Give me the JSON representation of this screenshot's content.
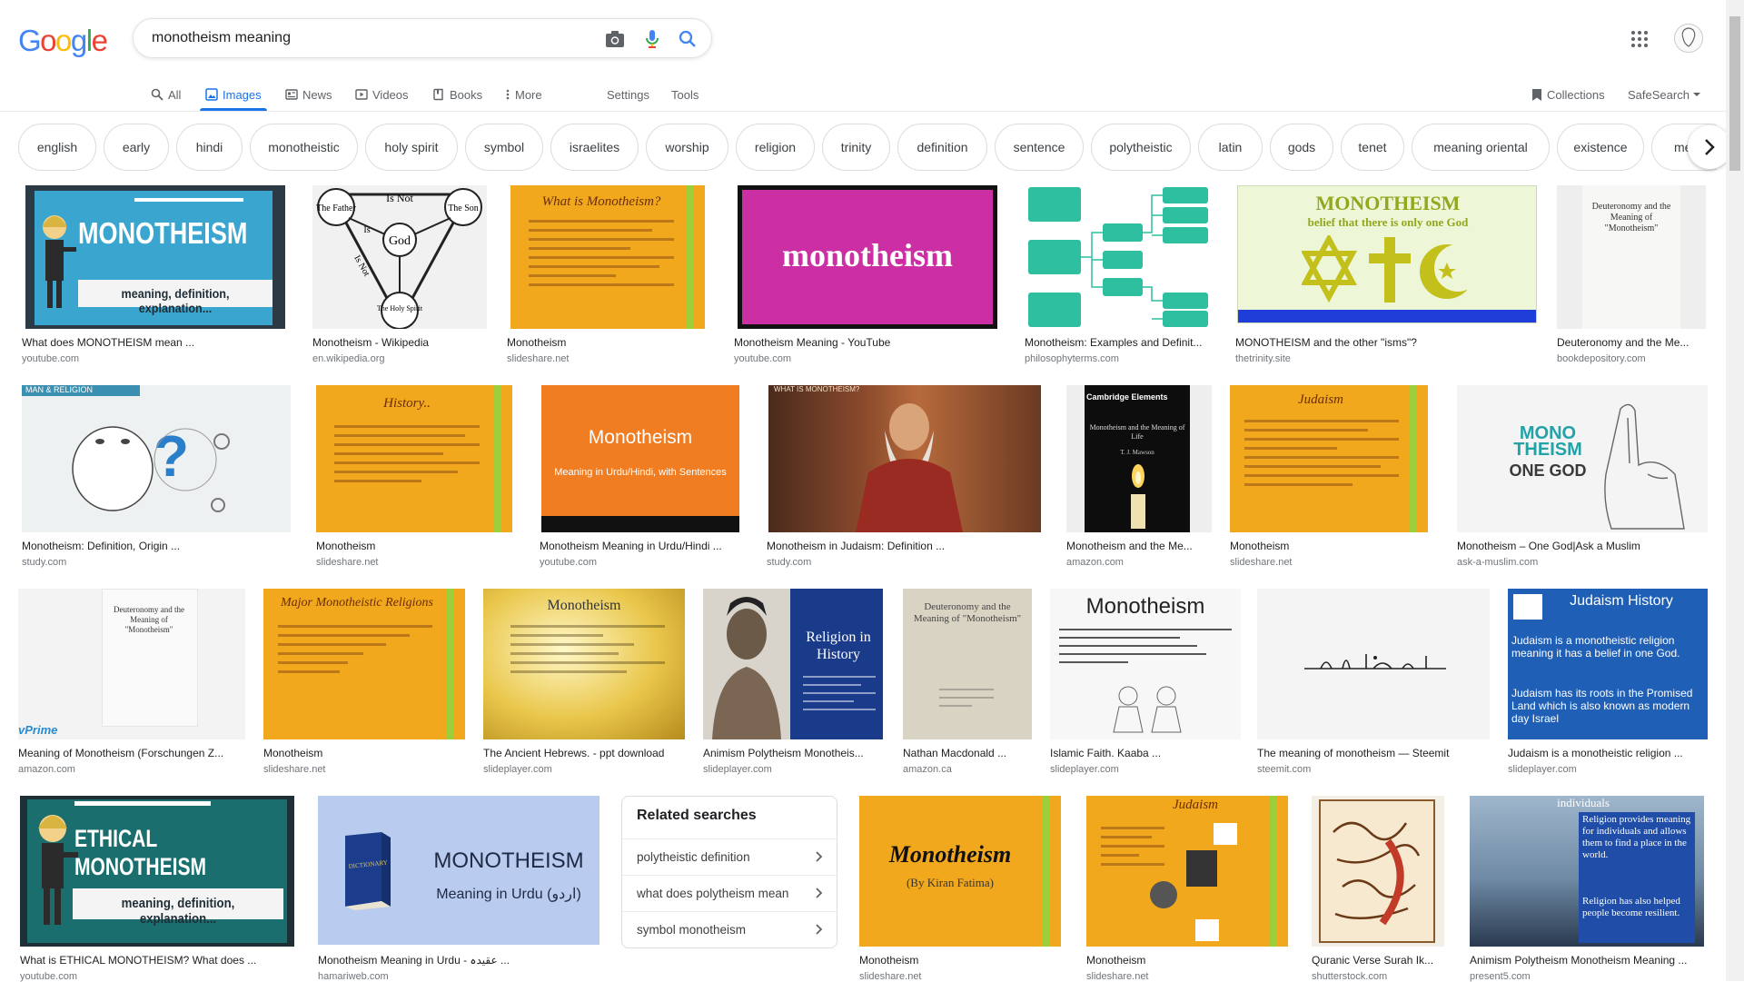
{
  "logo": {
    "letters": [
      "G",
      "o",
      "o",
      "g",
      "l",
      "e"
    ],
    "colors": [
      "#4285f4",
      "#ea4335",
      "#fbbc05",
      "#4285f4",
      "#34a853",
      "#ea4335"
    ]
  },
  "search": {
    "query": "monotheism meaning"
  },
  "icons": {
    "camera": "camera-icon",
    "mic": "microphone-icon",
    "search": "search-icon",
    "apps": "apps-grid-icon",
    "avatar": "user-avatar"
  },
  "tabs": {
    "all": "All",
    "images": "Images",
    "news": "News",
    "videos": "Videos",
    "books": "Books",
    "more": "More",
    "settings": "Settings",
    "tools": "Tools",
    "collections": "Collections",
    "safesearch": "SafeSearch"
  },
  "chips": [
    "english",
    "early",
    "hindi",
    "monotheistic",
    "holy spirit",
    "symbol",
    "israelites",
    "worship",
    "religion",
    "trinity",
    "definition",
    "sentence",
    "polytheistic",
    "latin",
    "gods",
    "tenet",
    "meaning oriental",
    "existence",
    "meaning"
  ],
  "results": [
    {
      "caption": "What does MONOTHEISM mean ...",
      "source": "youtube.com",
      "overlay": "MONOTHEISM",
      "overlay2": "meaning, definition, explanation..."
    },
    {
      "caption": "Monotheism - Wikipedia",
      "source": "en.wikipedia.org",
      "t1": "Is Not",
      "t2": "The Father",
      "t3": "The Son",
      "t4": "God",
      "t5": "The Holy Spirit",
      "t6": "Is",
      "t7": "Is Not"
    },
    {
      "caption": "Monotheism",
      "source": "slideshare.net",
      "overlay": "What is Monotheism?"
    },
    {
      "caption": "Monotheism Meaning - YouTube",
      "source": "youtube.com",
      "overlay": "monotheism"
    },
    {
      "caption": "Monotheism: Examples and Definit...",
      "source": "philosophyterms.com"
    },
    {
      "caption": "MONOTHEISM and the other \"isms\"?",
      "source": "thetrinity.site",
      "overlay": "MONOTHEISM",
      "overlay2": "belief that there is only one God"
    },
    {
      "caption": "Deuteronomy and the Me...",
      "source": "bookdepository.com",
      "overlay": "Deuteronomy and the Meaning of \"Monotheism\""
    },
    {
      "caption": "Monotheism: Definition, Origin ...",
      "source": "study.com",
      "overlay": "MAN & RELIGION"
    },
    {
      "caption": "Monotheism",
      "source": "slideshare.net",
      "overlay": "History.."
    },
    {
      "caption": "Monotheism Meaning in Urdu/Hindi ...",
      "source": "youtube.com",
      "overlay": "Monotheism",
      "overlay2": "Meaning in Urdu/Hindi, with Sentences"
    },
    {
      "caption": "Monotheism in Judaism: Definition ...",
      "source": "study.com",
      "overlay": "WHAT IS MONOTHEISM?"
    },
    {
      "caption": "Monotheism and the Me...",
      "source": "amazon.com",
      "overlay": "Cambridge Elements",
      "overlay2": "Monotheism and the Meaning of Life",
      "overlay3": "T. J. Mawson"
    },
    {
      "caption": "Monotheism",
      "source": "slideshare.net",
      "overlay": "Judaism"
    },
    {
      "caption": "Monotheism – One God|Ask a Muslim",
      "source": "ask-a-muslim.com",
      "overlay": "MONO THEISM",
      "overlay2": "ONE GOD"
    },
    {
      "caption": "Meaning of Monotheism (Forschungen Z...",
      "source": "amazon.com",
      "overlay": "Deuteronomy and the Meaning of \"Monotheism\"",
      "overlay2": "vPrime"
    },
    {
      "caption": "Monotheism",
      "source": "slideshare.net",
      "overlay": "Major Monotheistic Religions"
    },
    {
      "caption": "The Ancient Hebrews. - ppt download",
      "source": "slideplayer.com",
      "overlay": "Monotheism"
    },
    {
      "caption": "Animism Polytheism Monotheis...",
      "source": "slideplayer.com",
      "overlay": "Religion in History"
    },
    {
      "caption": "Nathan Macdonald ...",
      "source": "amazon.ca",
      "overlay": "Deuteronomy and the Meaning of \"Monotheism\""
    },
    {
      "caption": "Islamic Faith. Kaaba ...",
      "source": "slideplayer.com",
      "overlay": "Monotheism"
    },
    {
      "caption": "The meaning of monotheism — Steemit",
      "source": "steemit.com"
    },
    {
      "caption": "Judaism is a monotheistic religion ...",
      "source": "slideplayer.com",
      "overlay": "Judaism History",
      "overlay2": "Judaism is a monotheistic religion meaning it has a belief in one God.",
      "overlay3": "Judaism has its roots in the Promised Land which is also known as modern day Israel"
    },
    {
      "caption": "What is ETHICAL MONOTHEISM? What does ...",
      "source": "youtube.com",
      "overlay": "ETHICAL MONOTHEISM",
      "overlay2": "meaning, definition, explanation..."
    },
    {
      "caption": "Monotheism Meaning in Urdu - عقیدہ ...",
      "source": "hamariweb.com",
      "overlay": "MONOTHEISM",
      "overlay2": "Meaning in Urdu (اردو)"
    },
    {
      "caption": "Monotheism",
      "source": "slideshare.net",
      "overlay": "Monotheism",
      "overlay2": "(By Kiran Fatima)"
    },
    {
      "caption": "Monotheism",
      "source": "slideshare.net",
      "overlay": "Judaism"
    },
    {
      "caption": "Quranic Verse Surah Ik...",
      "source": "shutterstock.com"
    },
    {
      "caption": "Animism Polytheism Monotheism Meaning ...",
      "source": "present5.com",
      "overlay": "individuals",
      "overlay2": "Religion provides meaning for individuals and allows them to find a place in the world.",
      "overlay3": "Religion has also helped people become resilient."
    }
  ],
  "related": {
    "title": "Related searches",
    "items": [
      "polytheistic definition",
      "what does polytheism mean",
      "symbol monotheism"
    ]
  }
}
